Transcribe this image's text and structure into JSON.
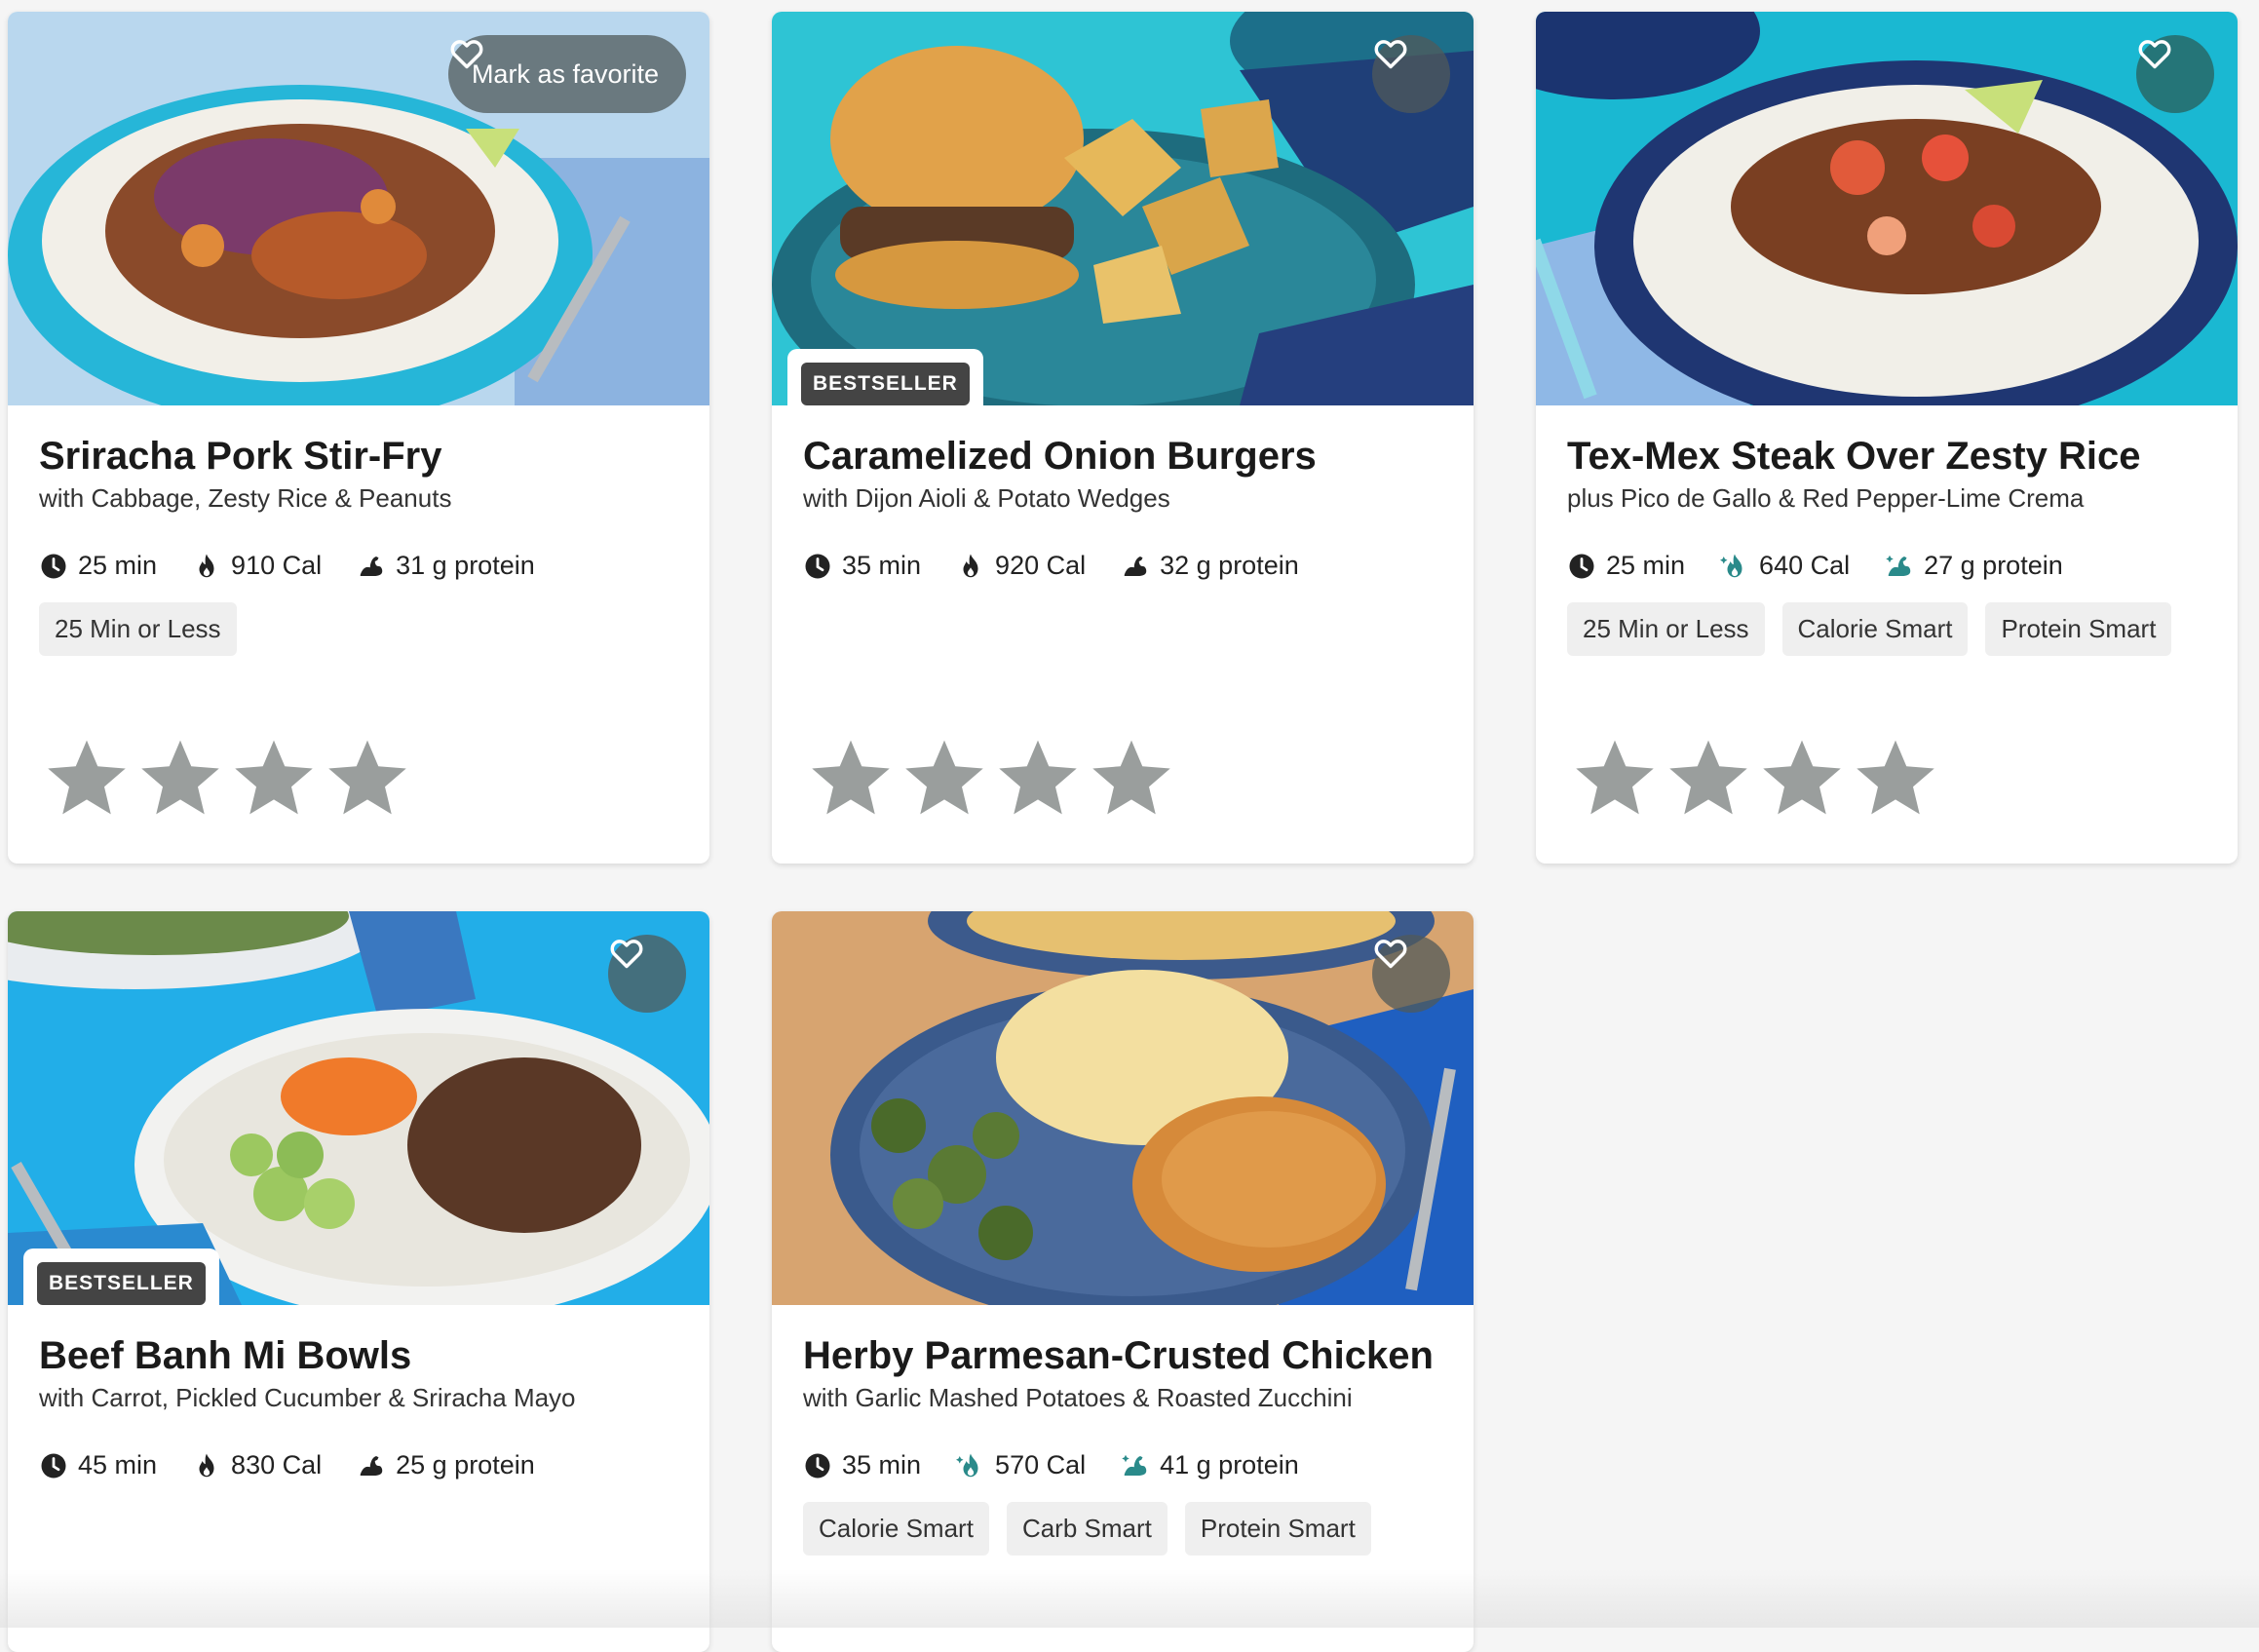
{
  "favorite": {
    "label": "Mark as favorite"
  },
  "badge_text": "BESTSELLER",
  "colors": {
    "tag_bg": "#efefef",
    "star": "#9a9e9d",
    "badge": "#444444",
    "smart_icon": "#2a8a8a"
  },
  "cards": [
    {
      "title": "Sriracha Pork Stir-Fry",
      "subtitle": "with Cabbage, Zesty Rice & Peanuts",
      "time": "25 min",
      "cal": "910 Cal",
      "protein": "31 g protein",
      "tags": [
        "25 Min or Less"
      ],
      "stars": 4
    },
    {
      "title": "Caramelized Onion Burgers",
      "subtitle": "with Dijon Aioli & Potato Wedges",
      "badge": "BESTSELLER",
      "time": "35 min",
      "cal": "920 Cal",
      "protein": "32 g protein",
      "tags": [],
      "stars": 4
    },
    {
      "title": "Tex-Mex Steak Over Zesty Rice",
      "subtitle": "plus Pico de Gallo & Red Pepper-Lime Crema",
      "time": "25 min",
      "cal": "640 Cal",
      "protein": "27 g protein",
      "tags": [
        "25 Min or Less",
        "Calorie Smart",
        "Protein Smart"
      ],
      "stars": 4
    },
    {
      "title": "Beef Banh Mi Bowls",
      "subtitle": "with Carrot, Pickled Cucumber & Sriracha Mayo",
      "badge": "BESTSELLER",
      "time": "45 min",
      "cal": "830 Cal",
      "protein": "25 g protein",
      "tags": []
    },
    {
      "title": "Herby Parmesan-Crusted Chicken",
      "subtitle": "with Garlic Mashed Potatoes & Roasted Zucchini",
      "time": "35 min",
      "cal": "570 Cal",
      "protein": "41 g protein",
      "tags": [
        "Calorie Smart",
        "Carb Smart",
        "Protein Smart"
      ]
    }
  ]
}
